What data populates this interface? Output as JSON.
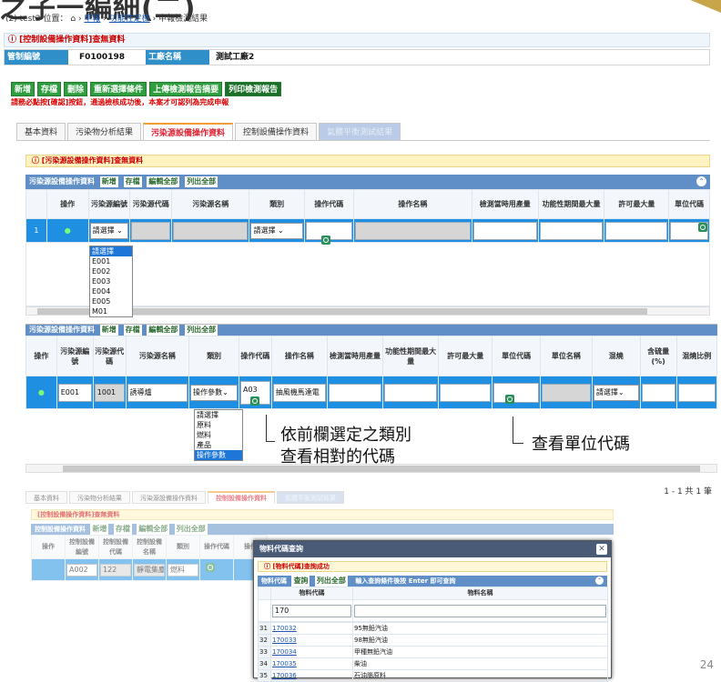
{
  "slide": {
    "title": "之子一編細(二)",
    "page_number": "24"
  },
  "breadcrumb": {
    "prefix": "(2) test2 位置：",
    "home_icon": "home-icon",
    "item1": "申報",
    "item2": "功能性定檢",
    "item3": "申報檢測結果"
  },
  "header": {
    "title": "[控制設備操作資料]查無資料"
  },
  "info": {
    "label1": "管制編號",
    "value1": "F0100198",
    "label2": "工廠名稱",
    "value2": "測試工廠2"
  },
  "toolbar": {
    "buttons": [
      "新增",
      "存檔",
      "刪除",
      "重新選擇條件",
      "上傳檢測報告摘要",
      "列印檢測報告"
    ]
  },
  "notice": "請務必點按[確認]按鈕，通過檢核成功後，本案才可認列為完成申報",
  "tabs": [
    "基本資料",
    "污染物分析結果",
    "污染源設備操作資料",
    "控制設備操作資料",
    "氣體平衡測試結果"
  ],
  "panel1": {
    "title": "[污染源設備操作資料]查無資料",
    "grid_title": "污染源設備操作資料",
    "grid_buttons": [
      "新增",
      "存檔",
      "編輯全部",
      "列出全部"
    ],
    "columns": [
      "操作",
      "污染源編號",
      "污染源代碼",
      "污染源名稱",
      "類別",
      "操作代碼",
      "操作名稱",
      "檢測當時用產量",
      "功能性期間最大量",
      "許可最大量",
      "單位代碼"
    ],
    "row_no": "1",
    "select1": "請選擇",
    "select2": "請選擇",
    "dropdown": [
      "請選擇",
      "E001",
      "E002",
      "E003",
      "E004",
      "E005",
      "M01"
    ]
  },
  "panel2": {
    "grid_title": "污染源設備操作資料",
    "grid_buttons": [
      "新增",
      "存檔",
      "編輯全部",
      "列出全部"
    ],
    "columns": [
      "操作",
      "污染源編號",
      "污染源代碼",
      "污染源名稱",
      "類別",
      "操作代碼",
      "操作名稱",
      "檢測當時用產量",
      "功能性期間最大量",
      "許可最大量",
      "單位代碼",
      "單位名稱",
      "混燒",
      "含硫量(%)",
      "混燒比例"
    ],
    "row": {
      "code": "E001",
      "src": "1001",
      "name": "誘導爐",
      "cat": "操作參數",
      "op": "A03",
      "opname": "抽風機馬達電",
      "mix": "請選擇"
    },
    "dropdown": [
      "請選擇",
      "原料",
      "燃料",
      "產品",
      "操作參數"
    ],
    "pager": "1 - 1 共 1 筆"
  },
  "callouts": {
    "left": [
      "依前欄選定之類別",
      "查看相對的代碼"
    ],
    "right": "查看單位代碼"
  },
  "panel3": {
    "tabs": [
      "基本資料",
      "污染物分析結果",
      "污染源設備操作資料",
      "控制設備操作資料",
      "氣體平衡測試結果"
    ],
    "title": "[控制設備操作資料]查無資料",
    "grid_title": "控制設備操作資料",
    "grid_buttons": [
      "新增",
      "存檔",
      "編輯全部",
      "列出全部"
    ],
    "columns": [
      "操作",
      "控制設備編號",
      "控制設備代碼",
      "控制設備名稱",
      "類別",
      "操作代碼",
      "操作"
    ],
    "row": {
      "code": "A002",
      "src": "122",
      "name": "靜電集塵器",
      "cat": "燃料"
    }
  },
  "modal": {
    "title": "物料代碼查詢",
    "status": "[物料代碼]查詢成功",
    "grid_title": "物料代碼",
    "buttons": [
      "查詢",
      "列出全部"
    ],
    "hint": "輸入查詢條件後按 Enter 即可查詢",
    "columns": [
      "物料代碼",
      "物料名稱"
    ],
    "search": "170",
    "rows": [
      {
        "no": "31",
        "code": "170032",
        "name": "95無鉛汽油"
      },
      {
        "no": "32",
        "code": "170033",
        "name": "98無鉛汽油"
      },
      {
        "no": "33",
        "code": "170034",
        "name": "甲種無鉛汽油"
      },
      {
        "no": "34",
        "code": "170035",
        "name": "柴油"
      },
      {
        "no": "35",
        "code": "170036",
        "name": "石油腦原料"
      }
    ]
  }
}
